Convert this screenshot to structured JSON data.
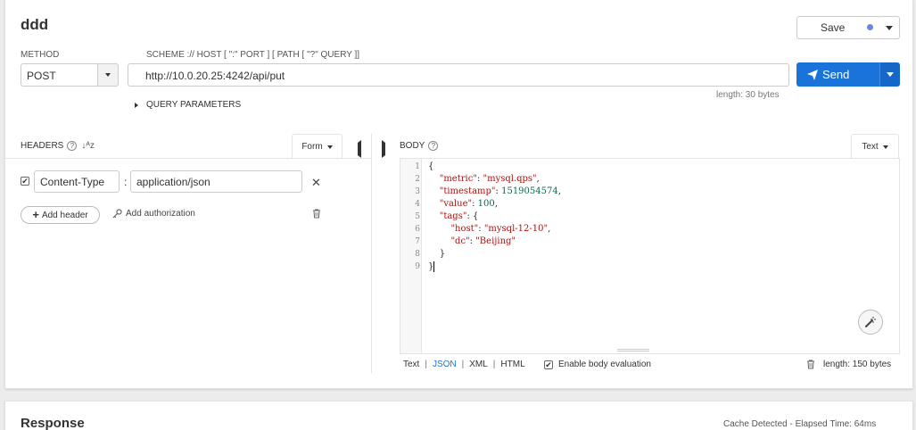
{
  "request": {
    "title": "ddd",
    "save_label": "Save",
    "method_label": "METHOD",
    "method_value": "POST",
    "scheme_label": "SCHEME :// HOST [ \":\" PORT ] [ PATH [ \"?\" QUERY ]]",
    "url": "http://10.0.20.25:4242/api/put",
    "url_length": "length: 30 bytes",
    "send_label": "Send",
    "query_params_label": "QUERY PARAMETERS"
  },
  "headers": {
    "label": "HEADERS",
    "help": "?",
    "sort_icon_text": "↓ᴬᴢ",
    "mode": "Form",
    "items": [
      {
        "enabled": true,
        "name": "Content-Type",
        "value": "application/json"
      }
    ],
    "add_header_label": "Add header",
    "add_authorization_label": "Add authorization"
  },
  "body": {
    "label": "BODY",
    "help": "?",
    "mode": "Text",
    "line_numbers": [
      "1",
      "2",
      "3",
      "4",
      "5",
      "6",
      "7",
      "8",
      "9"
    ],
    "code": {
      "l1": "{",
      "l2_key": "\"metric\"",
      "l2_val": "\"mysql.qps\"",
      "l3_key": "\"timestamp\"",
      "l3_val": "1519054574",
      "l4_key": "\"value\"",
      "l4_val": "100",
      "l5_key": "\"tags\"",
      "l6_key": "\"host\"",
      "l6_val": "\"mysql-12-10\"",
      "l7_key": "\"dc\"",
      "l7_val": "\"Beijing\"",
      "l8": "}",
      "l9": "}"
    },
    "formats": [
      "Text",
      "JSON",
      "XML",
      "HTML"
    ],
    "separator": "|",
    "active_format": "JSON",
    "enable_eval_label": "Enable body evaluation",
    "enable_eval_checked": true,
    "length": "length: 150 bytes"
  },
  "response": {
    "title": "Response",
    "status": "Cache Detected - Elapsed Time: 64ms"
  },
  "colors": {
    "primary": "#1a73d9",
    "save_dot": "#6a85e8"
  }
}
